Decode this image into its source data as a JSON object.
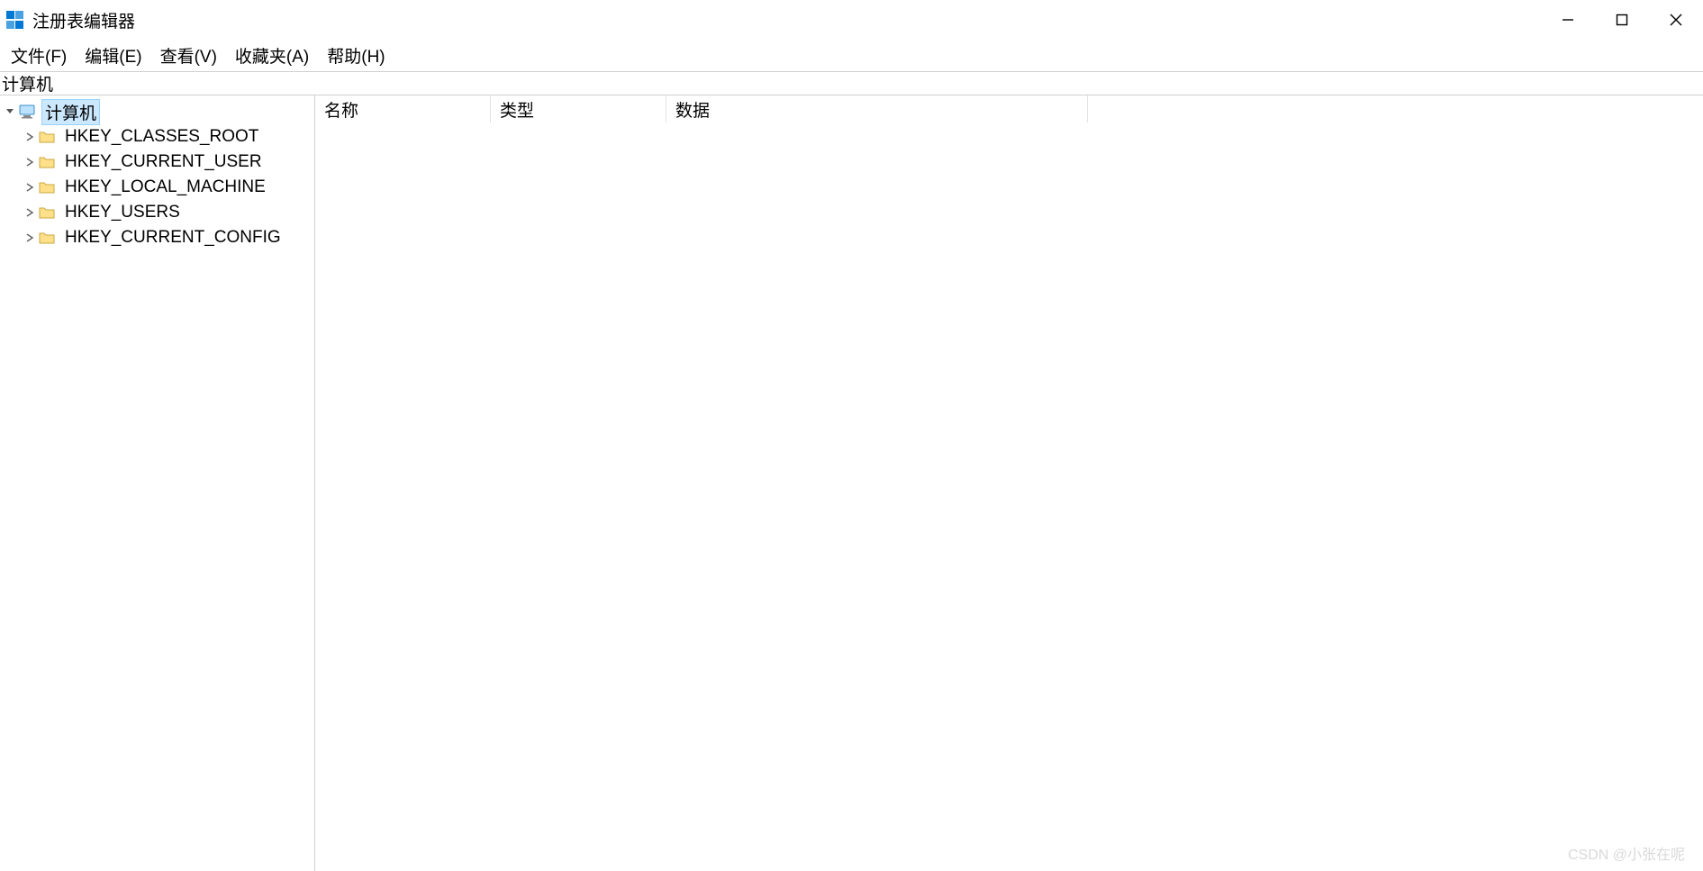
{
  "window": {
    "title": "注册表编辑器"
  },
  "menu": {
    "items": [
      "文件(F)",
      "编辑(E)",
      "查看(V)",
      "收藏夹(A)",
      "帮助(H)"
    ]
  },
  "path": "计算机",
  "tree": {
    "root": {
      "label": "计算机",
      "selected": true,
      "children": [
        {
          "label": "HKEY_CLASSES_ROOT"
        },
        {
          "label": "HKEY_CURRENT_USER"
        },
        {
          "label": "HKEY_LOCAL_MACHINE"
        },
        {
          "label": "HKEY_USERS"
        },
        {
          "label": "HKEY_CURRENT_CONFIG"
        }
      ]
    }
  },
  "values": {
    "columns": {
      "name": "名称",
      "type": "类型",
      "data": "数据"
    },
    "rows": []
  },
  "watermark": "CSDN @小张在呢"
}
